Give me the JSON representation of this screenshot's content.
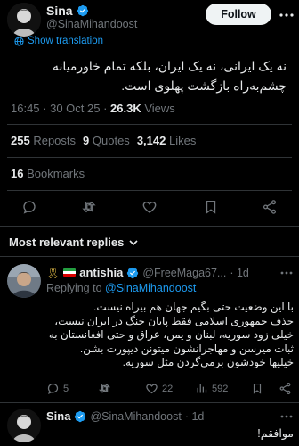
{
  "author": {
    "name": "Sina",
    "handle": "@SinaMihandoost",
    "follow_label": "Follow"
  },
  "translation": {
    "label": "Show translation"
  },
  "tweet": {
    "text": "نه یک ایرانی، نه یک ایران، بلکه تمام خاورمیانه چشم‌به‌راه بازگشت پهلوی است.",
    "time": "16:45 · 30 Oct 25 · ",
    "views_count": "26.3K",
    "views_label": "Views"
  },
  "stats": {
    "reposts_count": "255",
    "reposts_label": "Reposts",
    "quotes_count": "9",
    "quotes_label": "Quotes",
    "likes_count": "3,142",
    "likes_label": "Likes",
    "bookmarks_count": "16",
    "bookmarks_label": "Bookmarks"
  },
  "replies_header": {
    "label": "Most relevant replies"
  },
  "reply1": {
    "name": "antishia",
    "handle": "@FreeMaga67...",
    "time": "· 1d",
    "replying_prefix": "Replying to",
    "replying_to": "@SinaMihandoost",
    "text_lines": [
      "با این وضعیت حتی بگیم جهان هم بیراه نیست.",
      "حذف جمهوری اسلامی فقط پایان جنگ در ایران نیست،",
      "خیلی زود سوریه، لبنان و یمن، عراق و حتی افغانستان به",
      "ثبات میرسن و مهاجرانشون میتونن دیپورت بشن.",
      "خیلیها خودشون برمی‌گردن مثل سوریه."
    ],
    "replies": "5",
    "likes": "22",
    "views": "592"
  },
  "reply2": {
    "name": "Sina",
    "handle": "@SinaMihandoost",
    "time": "· 1d",
    "text": "موافقم!"
  },
  "colors": {
    "background": "#000000",
    "text": "#e7e9ea",
    "muted": "#71767b",
    "accent": "#1d9bf0",
    "divider": "#2f3336"
  }
}
